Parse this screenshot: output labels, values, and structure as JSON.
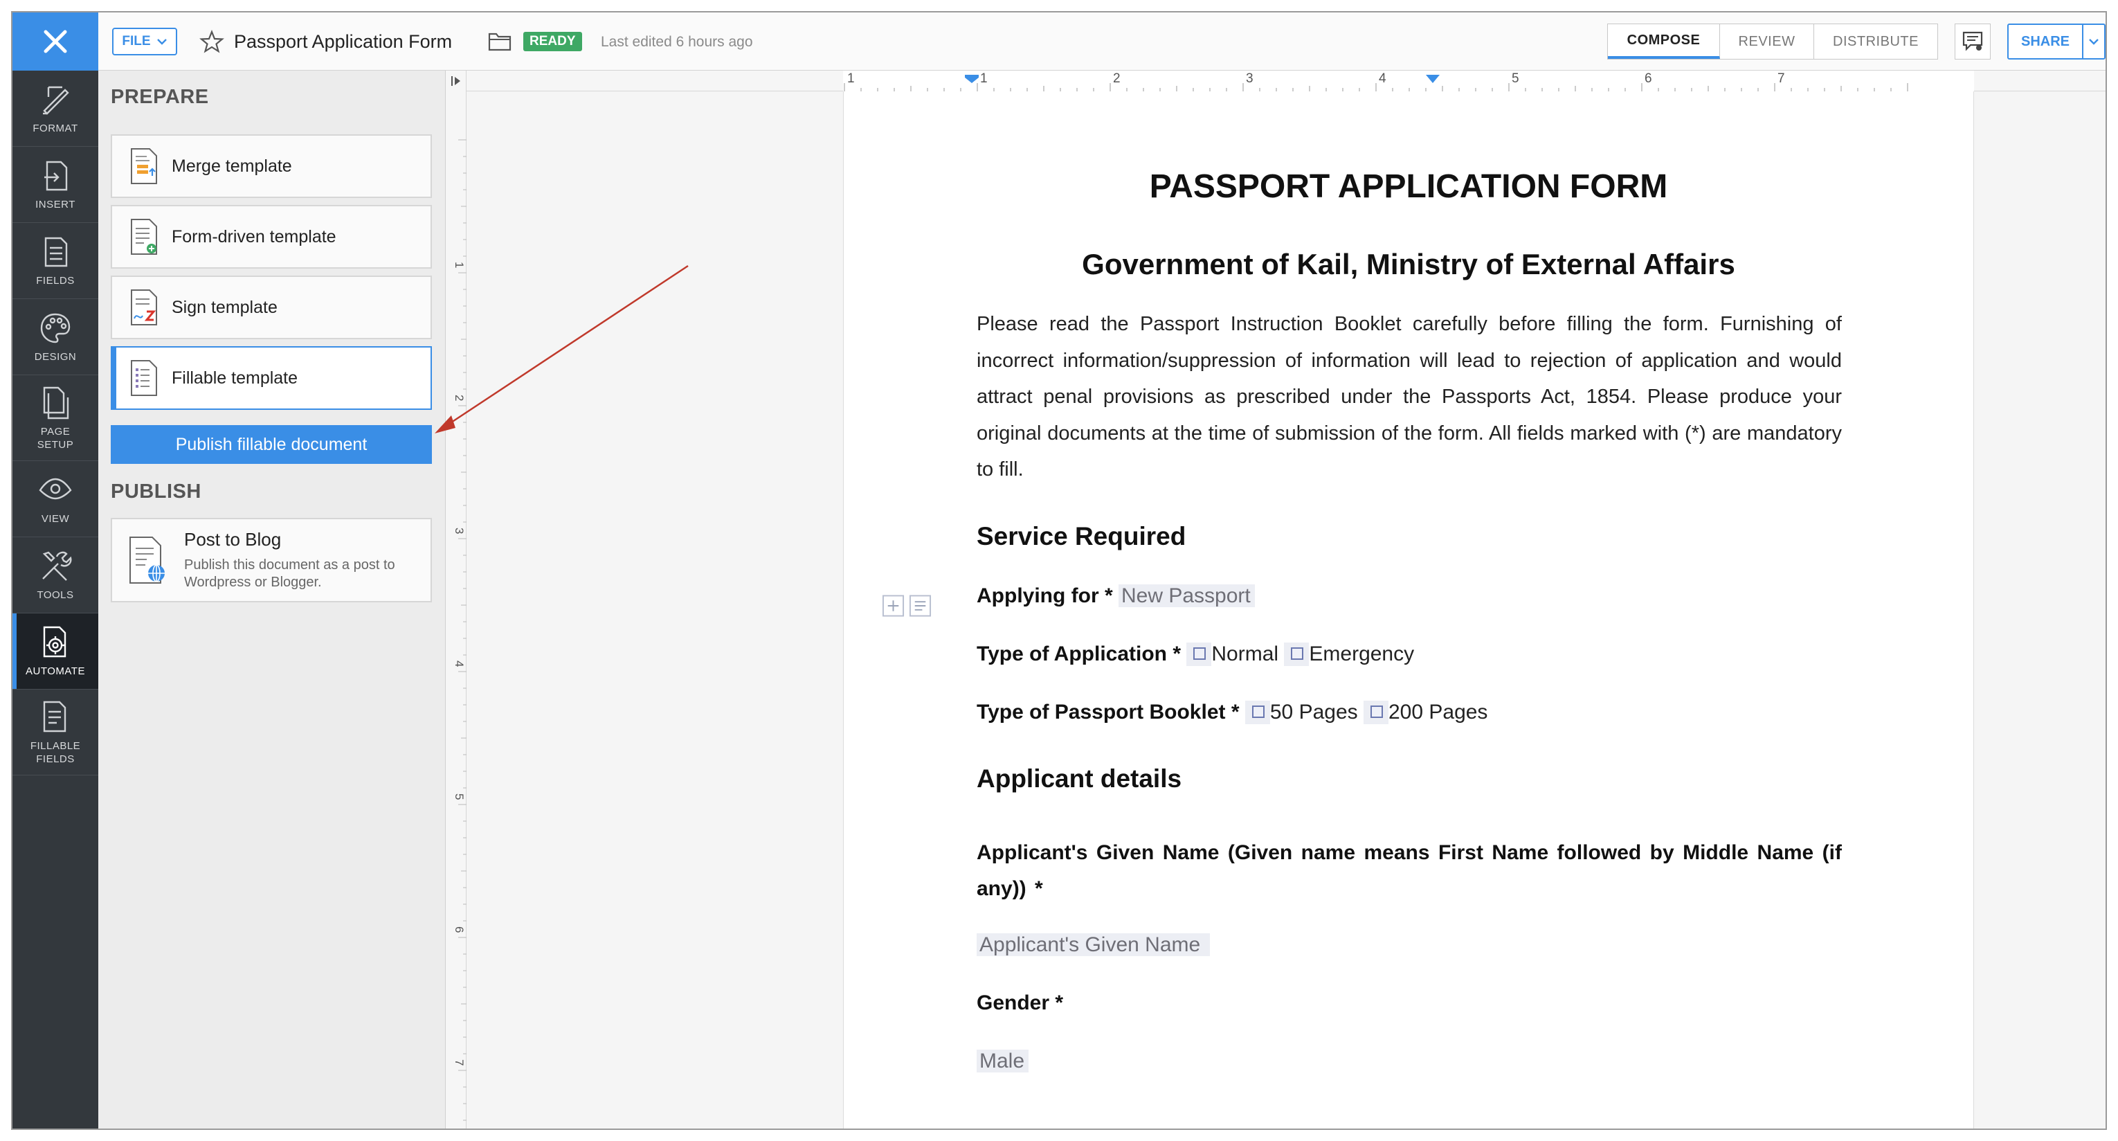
{
  "header": {
    "file_label": "FILE",
    "doc_title": "Passport Application Form",
    "status": "READY",
    "last_edited": "Last edited 6 hours ago",
    "modes": [
      "COMPOSE",
      "REVIEW",
      "DISTRIBUTE"
    ],
    "active_mode": "COMPOSE",
    "share_label": "SHARE"
  },
  "rail": {
    "items": [
      {
        "label": "FORMAT",
        "icon": "format-icon"
      },
      {
        "label": "INSERT",
        "icon": "insert-icon"
      },
      {
        "label": "FIELDS",
        "icon": "fields-icon"
      },
      {
        "label": "DESIGN",
        "icon": "palette-icon"
      },
      {
        "label": "PAGE\nSETUP",
        "icon": "page-setup-icon"
      },
      {
        "label": "VIEW",
        "icon": "eye-icon"
      },
      {
        "label": "TOOLS",
        "icon": "tools-icon"
      },
      {
        "label": "AUTOMATE",
        "icon": "automate-icon"
      },
      {
        "label": "FILLABLE\nFIELDS",
        "icon": "fillable-fields-icon"
      }
    ],
    "active": "AUTOMATE"
  },
  "panel": {
    "prepare_title": "PREPARE",
    "templates": [
      {
        "label": "Merge template",
        "icon": "merge-template-icon"
      },
      {
        "label": "Form-driven template",
        "icon": "form-template-icon"
      },
      {
        "label": "Sign template",
        "icon": "sign-template-icon"
      },
      {
        "label": "Fillable template",
        "icon": "fillable-template-icon"
      }
    ],
    "selected_template": "Fillable template",
    "publish_button": "Publish fillable document",
    "publish_title": "PUBLISH",
    "blog": {
      "title": "Post to Blog",
      "description": "Publish this document as a post to Wordpress or Blogger."
    }
  },
  "ruler": {
    "h_labels": [
      "1",
      "1",
      "2",
      "3",
      "4",
      "5",
      "6",
      "7"
    ],
    "v_labels": [
      "1",
      "2",
      "3",
      "4",
      "5",
      "6",
      "7"
    ]
  },
  "document": {
    "title": "PASSPORT APPLICATION FORM",
    "subtitle": "Government of Kail, Ministry of External Affairs",
    "intro": "Please read the Passport Instruction Booklet carefully before filling the form. Furnishing of incorrect information/suppression of information will lead to rejection of application and would attract penal provisions as prescribed under the Passports Act, 1854. Please produce your original documents at the time of submission of the form. All fields marked with (*) are mandatory to fill.",
    "section_service": "Service Required",
    "applying_for_label": "Applying for *",
    "applying_for_value": "New Passport",
    "type_app_label": "Type of Application *",
    "type_app_options": [
      "Normal",
      "Emergency"
    ],
    "type_booklet_label": "Type of Passport Booklet *",
    "type_booklet_options": [
      "50 Pages",
      "200 Pages"
    ],
    "section_applicant": "Applicant details",
    "given_name_label": "Applicant's Given Name (Given name means First Name followed by Middle Name (if any)) *",
    "given_name_placeholder": "Applicant's Given Name",
    "gender_label": "Gender *",
    "gender_value": "Male"
  },
  "colors": {
    "accent": "#3a8ee6",
    "rail_bg": "#33383d",
    "ready": "#3ea864",
    "annotation_arrow": "#c0392b"
  }
}
